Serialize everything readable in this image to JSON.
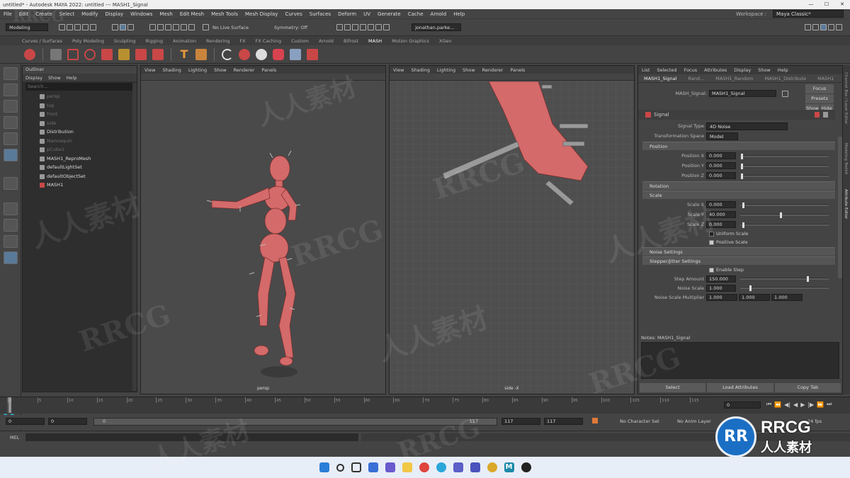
{
  "window": {
    "title": "untitled* - Autodesk MAYA 2022: untitled    ---    MASH1_Signal",
    "min": "—",
    "max": "☐",
    "close": "✕"
  },
  "menubar": [
    "File",
    "Edit",
    "Create",
    "Select",
    "Modify",
    "Display",
    "Windows",
    "Mesh",
    "Edit Mesh",
    "Mesh Tools",
    "Mesh Display",
    "Curves",
    "Surfaces",
    "Deform",
    "UV",
    "Generate",
    "Cache",
    "Arnold",
    "Help"
  ],
  "workspace": {
    "label": "Workspace :",
    "value": "Maya Classic*"
  },
  "statusline": {
    "mode": "Modeling",
    "live_surface": "No Live Surface",
    "symmetry": "Symmetry: Off",
    "user": "jonathan.parke..."
  },
  "shelf_tabs": [
    "Curves / Surfaces",
    "Poly Modeling",
    "Sculpting",
    "Rigging",
    "Animation",
    "Rendering",
    "FX",
    "FX Caching",
    "Custom",
    "Arnold",
    "Bifrost",
    "MASH",
    "Motion Graphics",
    "XGen"
  ],
  "shelf_active": "MASH",
  "outliner": {
    "title": "Outliner",
    "menu": [
      "Display",
      "Show",
      "Help"
    ],
    "search_placeholder": "Search...",
    "items": [
      {
        "label": "persp",
        "dim": true
      },
      {
        "label": "top",
        "dim": true
      },
      {
        "label": "front",
        "dim": true
      },
      {
        "label": "side",
        "dim": true
      },
      {
        "label": "Distribution",
        "dim": false
      },
      {
        "label": "Mannequin",
        "dim": true
      },
      {
        "label": "pCube1",
        "dim": true
      },
      {
        "label": "MASH1_ReproMesh",
        "dim": false
      },
      {
        "label": "defaultLightSet",
        "dim": false
      },
      {
        "label": "defaultObjectSet",
        "dim": false
      },
      {
        "label": "MASH1",
        "dim": false
      }
    ]
  },
  "viewport_menu": [
    "View",
    "Shading",
    "Lighting",
    "Show",
    "Renderer",
    "Panels"
  ],
  "viewport1": {
    "label": "persp"
  },
  "viewport2": {
    "label": "side -X"
  },
  "attr_editor": {
    "menu": [
      "List",
      "Selected",
      "Focus",
      "Attributes",
      "Display",
      "Show",
      "Help"
    ],
    "node_tabs": [
      "MASH1_Signal",
      "Rand...",
      "MASH1_Random",
      "MASH1_Distribute",
      "MASH1"
    ],
    "node_label": "MASH_Signal:",
    "node_value": "MASH1_Signal",
    "focus": "Focus",
    "presets": "Presets",
    "show": "Show",
    "hide": "Hide",
    "section": "Signal",
    "signal_type_label": "Signal Type",
    "signal_type": "4D Noise",
    "transform_space_label": "Transformation Space",
    "transform_space": "Model",
    "position_frame": "Position",
    "position": [
      {
        "label": "Position X",
        "value": "0.000"
      },
      {
        "label": "Position Y",
        "value": "0.000"
      },
      {
        "label": "Position Z",
        "value": "0.000"
      }
    ],
    "rotation_frame": "Rotation",
    "scale_frame": "Scale",
    "scale": [
      {
        "label": "Scale X",
        "value": "0.000",
        "knob": 0.02
      },
      {
        "label": "Scale Y",
        "value": "40.000",
        "knob": 0.45
      },
      {
        "label": "Scale Z",
        "value": "0.000",
        "knob": 0.02
      }
    ],
    "uniform_scale": "Uniform Scale",
    "positive_scale": "Positive Scale",
    "noise_frame": "Noise Settings",
    "stepper_frame": "Stepper/Jitter Settings",
    "enable_step": "Enable Step",
    "step_amount_label": "Step Amount",
    "step_amount": "150.000",
    "noise_scale_label": "Noise Scale",
    "noise_scale": "1.000",
    "nsm_label": "Noise Scale Multiplier",
    "nsm": [
      "1.000",
      "1.000",
      "1.000"
    ],
    "notes": "Notes: MASH1_Signal",
    "buttons": [
      "Select",
      "Load Attributes",
      "Copy Tab"
    ]
  },
  "side_tabs": [
    "Channel Box / Layer Editor",
    "Modeling Toolkit",
    "Attribute Editor"
  ],
  "timeline": {
    "ticks": [
      "0",
      "5",
      "10",
      "15",
      "20",
      "25",
      "30",
      "35",
      "40",
      "45",
      "50",
      "55",
      "60",
      "65",
      "70",
      "75",
      "80",
      "85",
      "90",
      "95",
      "100",
      "105",
      "110",
      "115"
    ],
    "current_frame": "0"
  },
  "range": {
    "start": "0",
    "start2": "0",
    "slider_start": "0",
    "slider_end": "117",
    "end": "117",
    "end2": "117",
    "character_set": "No Character Set",
    "anim_layer": "No Anim Layer",
    "fps": "24 fps"
  },
  "cmd": {
    "label": "MEL"
  },
  "watermarks": [
    "RRCG",
    "人人素材"
  ],
  "logo": {
    "brand": "RRCG",
    "sub": "人人素材"
  }
}
